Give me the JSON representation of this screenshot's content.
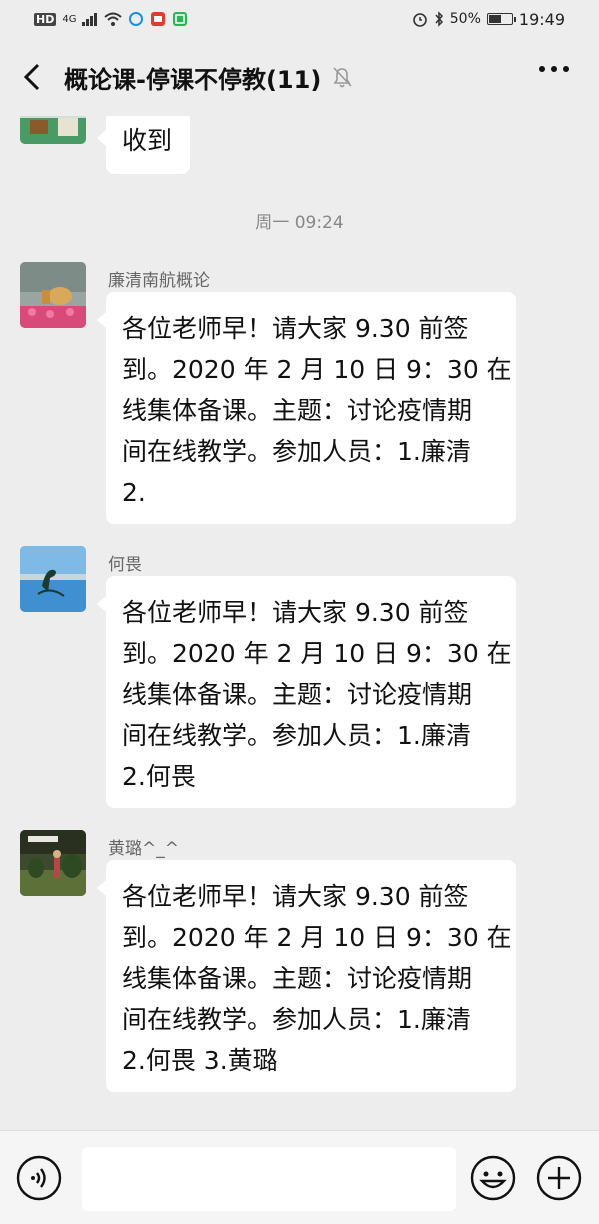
{
  "status_bar": {
    "network_label": "HD",
    "signal_label": "4G",
    "battery": "50%",
    "time": "19:49"
  },
  "nav": {
    "title": "概论课-停课不停教(11)"
  },
  "messages": {
    "first": {
      "text": "收到"
    },
    "time_label": "周一 09:24",
    "m1": {
      "sender": "廉清南航概论",
      "lines": [
        "各位老师早！请大家 9.30 前签",
        "到。2020 年 2 月 10 日 9：30 在",
        "线集体备课。主题：讨论疫情期",
        "间在线教学。参加人员：1.廉清",
        "2."
      ]
    },
    "m2": {
      "sender": "何畏",
      "lines": [
        "各位老师早！请大家 9.30 前签",
        "到。2020 年 2 月 10 日 9：30 在",
        "线集体备课。主题：讨论疫情期",
        "间在线教学。参加人员：1.廉清",
        "2.何畏"
      ]
    },
    "m3": {
      "sender": "黄璐^_^",
      "lines": [
        "各位老师早！请大家 9.30 前签",
        "到。2020 年 2 月 10 日 9：30 在",
        "线集体备课。主题：讨论疫情期",
        "间在线教学。参加人员：1.廉清",
        "2.何畏 3.黄璐"
      ]
    }
  },
  "input": {
    "placeholder": ""
  },
  "icons": {
    "back": "back-arrow-icon",
    "mute": "bell-off-icon",
    "more": "more-icon",
    "voice": "voice-icon",
    "emoji": "emoji-icon",
    "plus": "plus-icon"
  }
}
